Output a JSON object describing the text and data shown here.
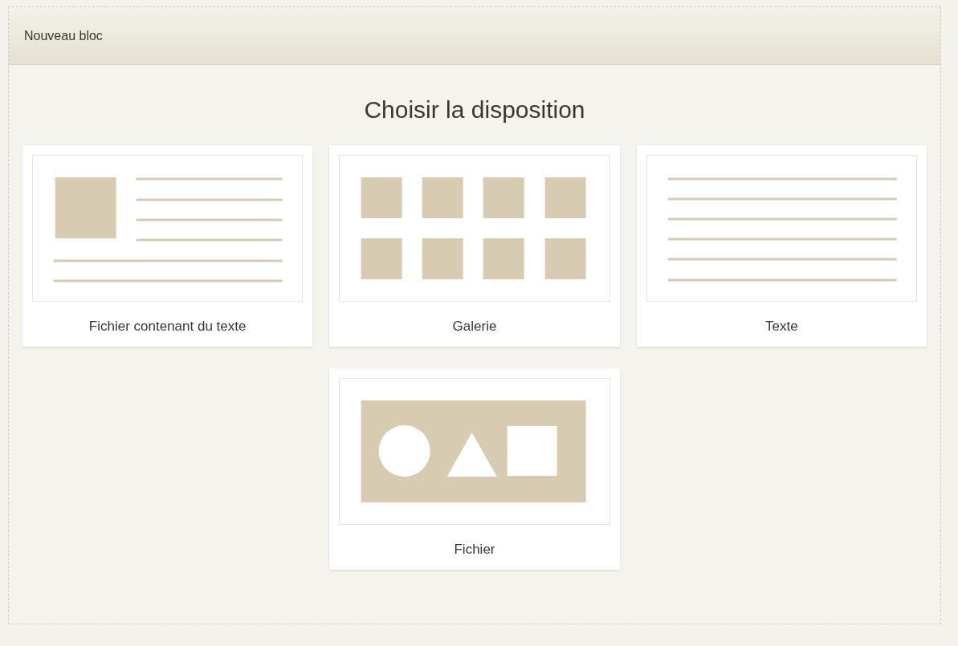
{
  "panel": {
    "title": "Nouveau bloc"
  },
  "heading": "Choisir la disposition",
  "layouts": [
    {
      "kind": "text-with-image",
      "label": "Fichier contenant du texte"
    },
    {
      "kind": "gallery",
      "label": "Galerie"
    },
    {
      "kind": "text",
      "label": "Texte"
    },
    {
      "kind": "file",
      "label": "Fichier"
    }
  ]
}
